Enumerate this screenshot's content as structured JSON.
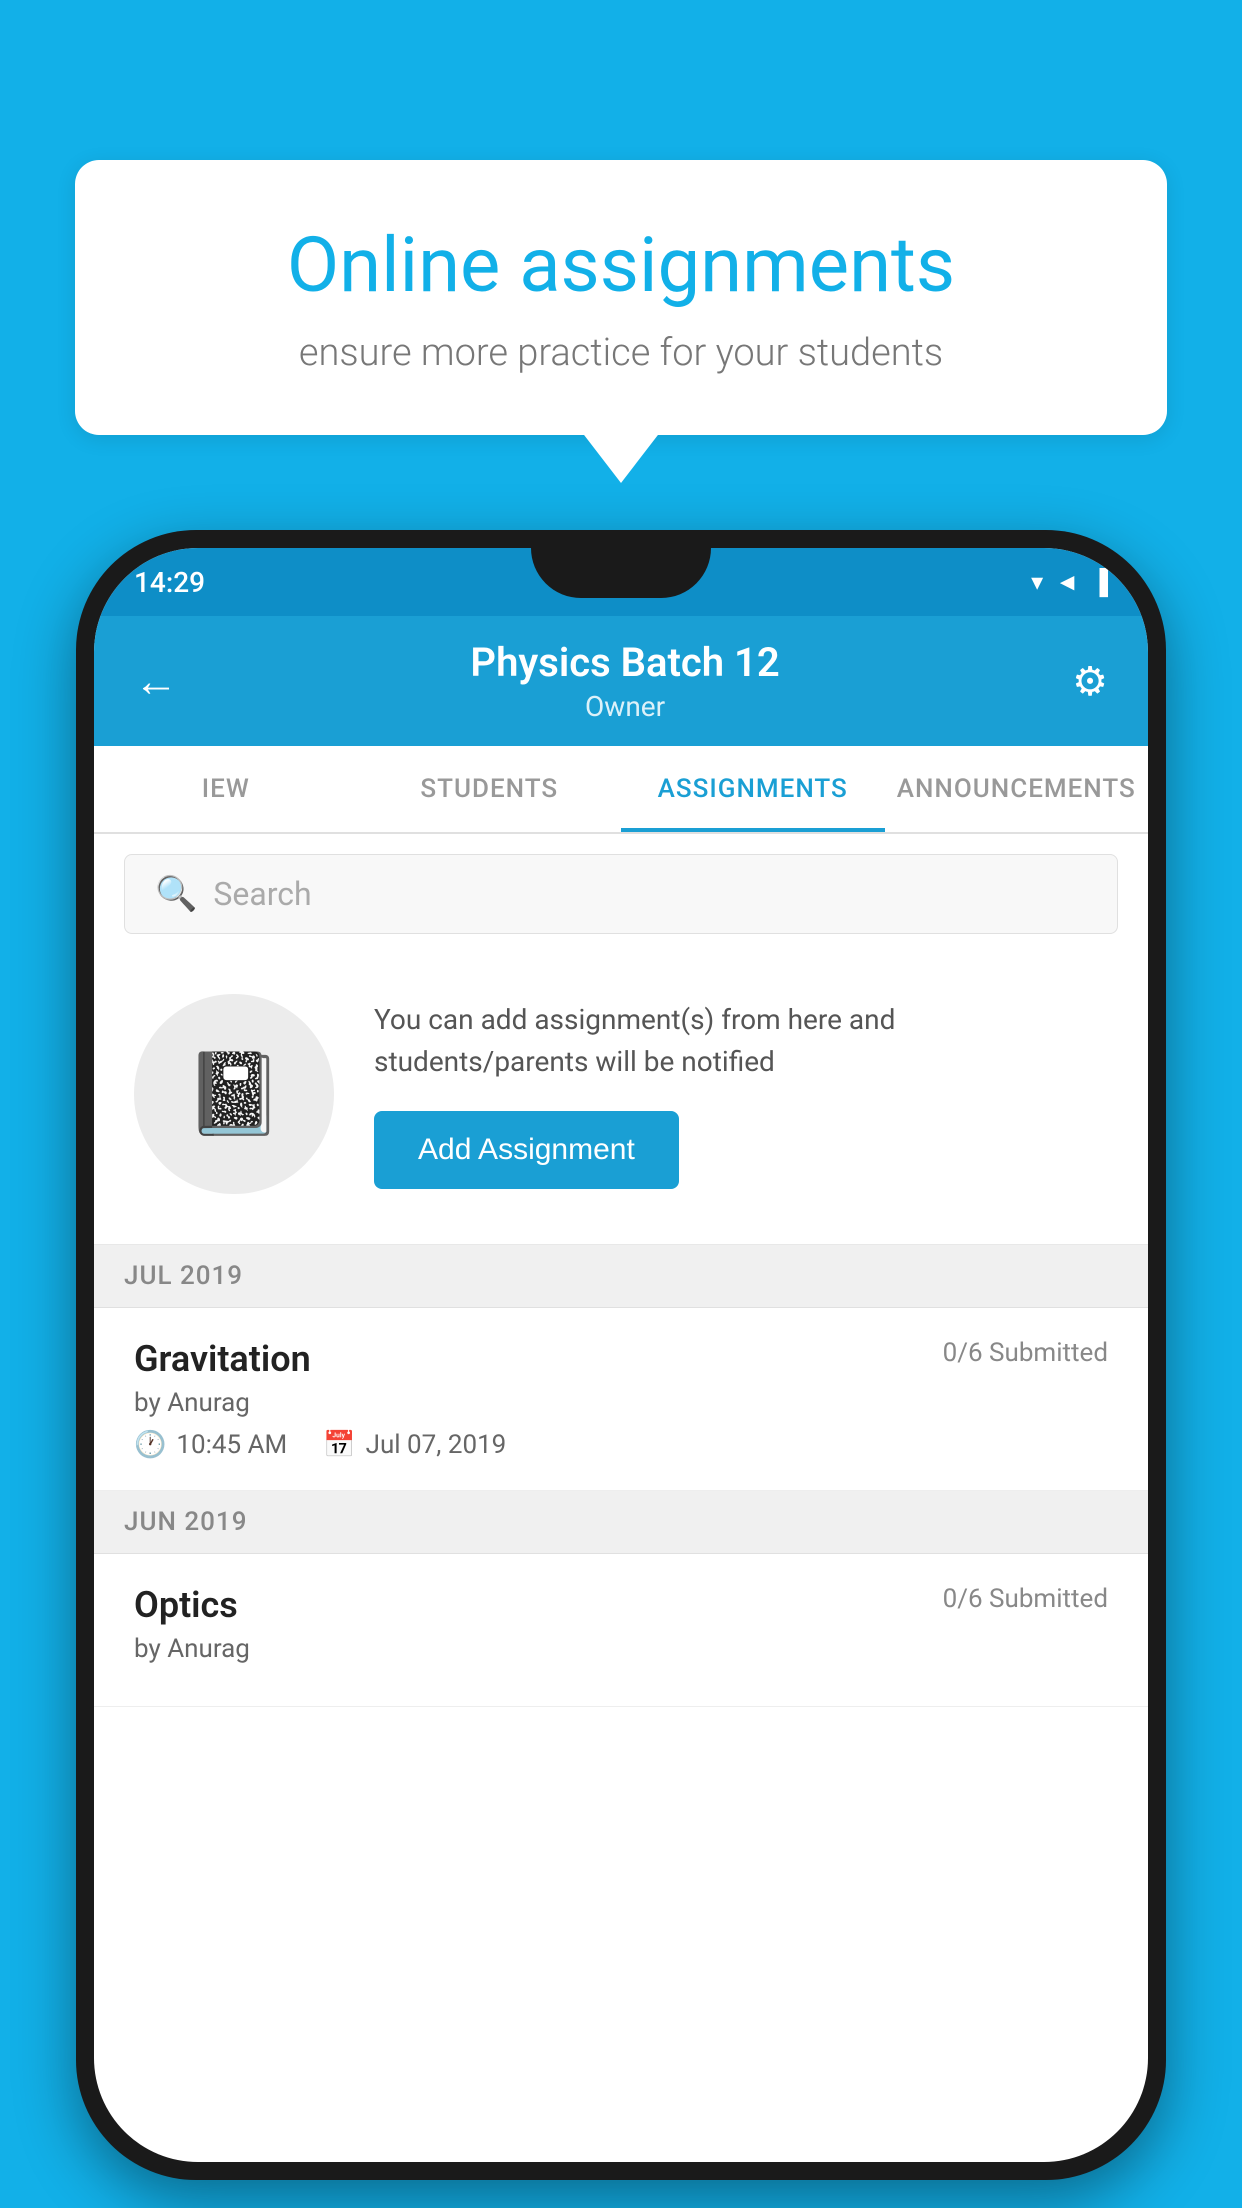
{
  "background_color": "#12B0E8",
  "speech_bubble": {
    "title": "Online assignments",
    "subtitle": "ensure more practice for your students"
  },
  "status_bar": {
    "time": "14:29",
    "wifi_icon": "▾",
    "signal_icon": "▲",
    "battery_icon": "▐"
  },
  "app_bar": {
    "back_label": "←",
    "title": "Physics Batch 12",
    "subtitle": "Owner",
    "settings_label": "⚙"
  },
  "tabs": [
    {
      "label": "IEW",
      "active": false
    },
    {
      "label": "STUDENTS",
      "active": false
    },
    {
      "label": "ASSIGNMENTS",
      "active": true
    },
    {
      "label": "ANNOUNCEMENTS",
      "active": false
    }
  ],
  "search": {
    "placeholder": "Search"
  },
  "prompt": {
    "text": "You can add assignment(s) from here and students/parents will be notified",
    "button_label": "Add Assignment"
  },
  "sections": [
    {
      "month_label": "JUL 2019",
      "assignments": [
        {
          "title": "Gravitation",
          "submitted": "0/6 Submitted",
          "author": "by Anurag",
          "time": "10:45 AM",
          "date": "Jul 07, 2019"
        }
      ]
    },
    {
      "month_label": "JUN 2019",
      "assignments": [
        {
          "title": "Optics",
          "submitted": "0/6 Submitted",
          "author": "by Anurag",
          "time": "",
          "date": ""
        }
      ]
    }
  ]
}
